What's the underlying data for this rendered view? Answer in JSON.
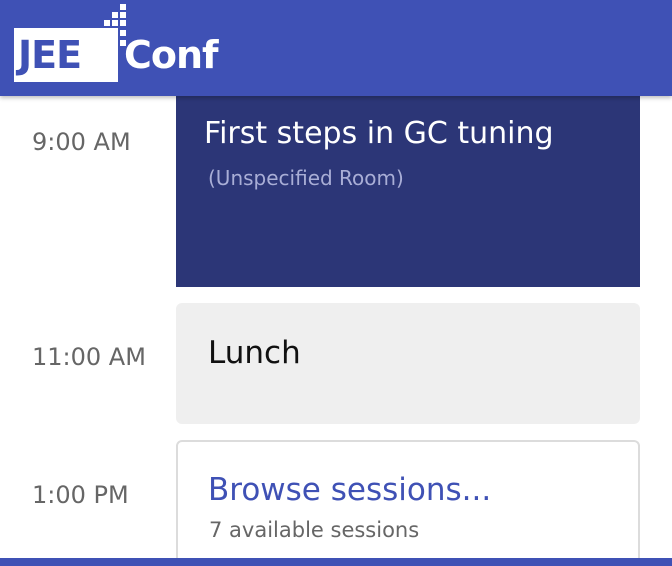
{
  "app": {
    "logo_left": "JEE",
    "logo_right": "Conf",
    "brand_color": "#3f51b5"
  },
  "schedule": {
    "slots": [
      {
        "time": "9:00 AM",
        "title": "First steps in GC tuning",
        "room": "(Unspecified Room)",
        "color": "#2c3677"
      },
      {
        "time": "11:00 AM",
        "title": "Lunch",
        "color": "#efefef"
      },
      {
        "time": "1:00 PM",
        "title": "Browse sessions...",
        "subtitle": "7 available sessions",
        "color": "#3f51b5"
      }
    ]
  }
}
